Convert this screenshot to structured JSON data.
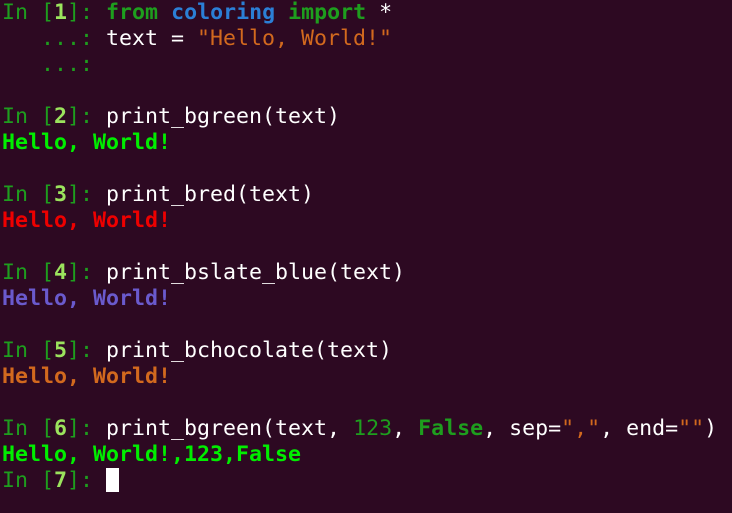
{
  "colors": {
    "background": "#2d0922",
    "prompt": "#1e9e1e",
    "prompt_number": "#9be35d",
    "string": "#d2691e",
    "module": "#2b7fd6",
    "out_green": "#00ee00",
    "out_red": "#ee0000",
    "out_slate_blue": "#6a5acd",
    "out_chocolate": "#d2691e"
  },
  "cells": [
    {
      "prompt_open": "In [",
      "number": "1",
      "prompt_close": "]: ",
      "kw_from": "from",
      "module": "coloring",
      "kw_import": "import",
      "star": " *",
      "cont1_prompt": "   ...: ",
      "cont1_code": "text = ",
      "cont1_string": "\"Hello, World!\"",
      "cont2_prompt": "   ...:"
    },
    {
      "prompt_open": "In [",
      "number": "2",
      "prompt_close": "]: ",
      "code": "print_bgreen(text)",
      "output": "Hello, World!"
    },
    {
      "prompt_open": "In [",
      "number": "3",
      "prompt_close": "]: ",
      "code": "print_bred(text)",
      "output": "Hello, World!"
    },
    {
      "prompt_open": "In [",
      "number": "4",
      "prompt_close": "]: ",
      "code": "print_bslate_blue(text)",
      "output": "Hello, World!"
    },
    {
      "prompt_open": "In [",
      "number": "5",
      "prompt_close": "]: ",
      "code": "print_bchocolate(text)",
      "output": "Hello, World!"
    },
    {
      "prompt_open": "In [",
      "number": "6",
      "prompt_close": "]: ",
      "code_a": "print_bgreen(text, ",
      "num": "123",
      "code_b": ", ",
      "bool": "False",
      "code_c": ", sep=",
      "sep_str": "\",\"",
      "code_d": ", end=",
      "end_str": "\"\"",
      "code_e": ")",
      "output": "Hello, World!,123,False"
    },
    {
      "prompt_open": "In [",
      "number": "7",
      "prompt_close": "]: "
    }
  ]
}
